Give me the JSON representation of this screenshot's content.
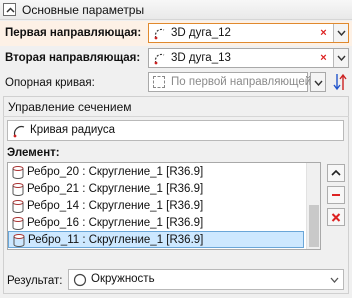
{
  "section": {
    "title": "Основные параметры"
  },
  "first_guide": {
    "label": "Первая направляющая:",
    "value": "3D дуга_12",
    "clear": "×"
  },
  "second_guide": {
    "label": "Вторая направляющая:",
    "value": "3D дуга_13",
    "clear": "×"
  },
  "support_curve": {
    "label": "Опорная кривая:",
    "placeholder": "По первой направляющей"
  },
  "section_control": {
    "title": "Управление сечением",
    "mode": "Кривая радиуса"
  },
  "elements": {
    "label": "Элемент:",
    "items": [
      "Ребро_20 : Скругление_1 [R36.9]",
      "Ребро_21 : Скругление_1 [R36.9]",
      "Ребро_14 : Скругление_1 [R36.9]",
      "Ребро_16 : Скругление_1 [R36.9]",
      "Ребро_11 : Скругление_1 [R36.9]"
    ],
    "selected_index": 4
  },
  "result": {
    "label": "Результат:",
    "value": "Окружность"
  },
  "colors": {
    "highlight_row": "#fdf1e6",
    "selection": "#cde8ff",
    "remove_red": "#d22222",
    "orange_border": "#e0892d"
  }
}
